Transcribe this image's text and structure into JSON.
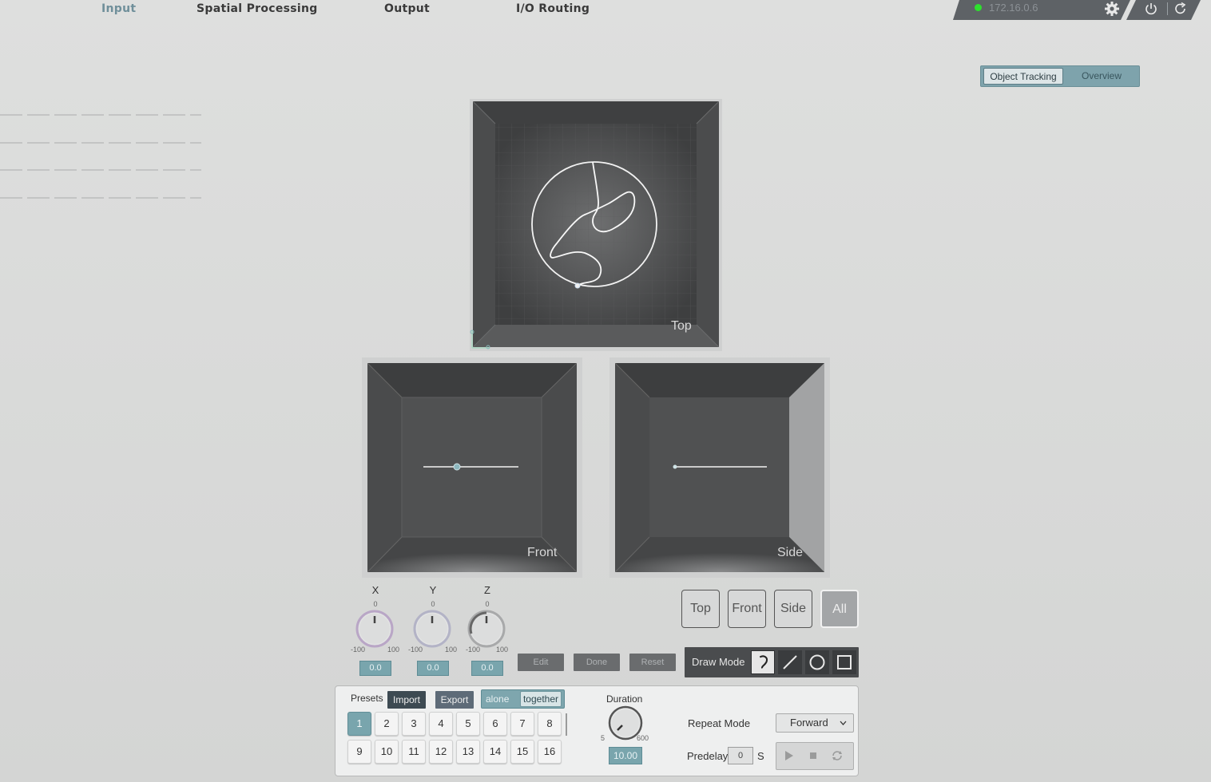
{
  "nav": {
    "tabs": [
      {
        "label": "Input",
        "active": true
      },
      {
        "label": "Spatial Processing"
      },
      {
        "label": "Output"
      },
      {
        "label": "I/O Routing"
      }
    ],
    "ip_address": "172.16.0.6",
    "status_color": "#2de02d"
  },
  "view_switch": {
    "tracking_label": "Object Tracking",
    "overview_label": "Overview"
  },
  "viewports": {
    "top_label": "Top",
    "front_label": "Front",
    "side_label": "Side"
  },
  "axes": [
    {
      "name": "X",
      "zero": "0",
      "min": "-100",
      "max": "100",
      "value": "0.0"
    },
    {
      "name": "Y",
      "zero": "0",
      "min": "-100",
      "max": "100",
      "value": "0.0"
    },
    {
      "name": "Z",
      "zero": "0",
      "min": "-100",
      "max": "100",
      "value": "0.0"
    }
  ],
  "edit_buttons": {
    "edit": "Edit",
    "done": "Done",
    "reset": "Reset"
  },
  "view_buttons": {
    "top": "Top",
    "front": "Front",
    "side": "Side",
    "all": "All"
  },
  "draw_mode": {
    "label": "Draw Mode",
    "tools": [
      "freehand-icon",
      "line-icon",
      "circle-icon",
      "square-icon"
    ],
    "selected": "freehand-icon"
  },
  "presets": {
    "label": "Presets",
    "import": "Import",
    "export": "Export",
    "mode_alone": "alone",
    "mode_together": "together",
    "numbers": [
      "1",
      "2",
      "3",
      "4",
      "5",
      "6",
      "7",
      "8",
      "9",
      "10",
      "11",
      "12",
      "13",
      "14",
      "15",
      "16"
    ],
    "selected": "1"
  },
  "duration": {
    "label": "Duration",
    "min": "5",
    "max": "600",
    "value": "10.00"
  },
  "repeat": {
    "label": "Repeat Mode",
    "value": "Forward"
  },
  "predelay": {
    "label": "Predelay",
    "value": "0",
    "unit": "S"
  },
  "accent": "#79a5ad"
}
